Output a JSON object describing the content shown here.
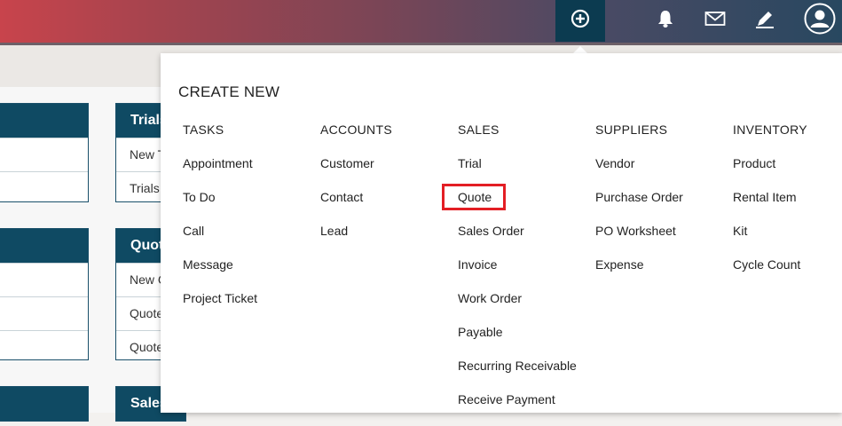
{
  "topbar": {
    "icons": [
      "plus-circle-icon",
      "bell-icon",
      "mail-icon",
      "pencil-icon",
      "user-icon"
    ]
  },
  "cards": {
    "trials": {
      "title": "Trials",
      "rows": [
        "New T",
        "Trials"
      ]
    },
    "quotes": {
      "title": "Quot",
      "rows": [
        "New C",
        "Quote",
        "Quote"
      ]
    },
    "sales": {
      "title": "Sales"
    }
  },
  "dropdown": {
    "title": "CREATE NEW",
    "columns": [
      {
        "header": "TASKS",
        "items": [
          "Appointment",
          "To Do",
          "Call",
          "Message",
          "Project Ticket"
        ]
      },
      {
        "header": "ACCOUNTS",
        "items": [
          "Customer",
          "Contact",
          "Lead"
        ]
      },
      {
        "header": "SALES",
        "items": [
          "Trial",
          "Quote",
          "Sales Order",
          "Invoice",
          "Work Order",
          "Payable",
          "Recurring Receivable",
          "Receive Payment"
        ]
      },
      {
        "header": "SUPPLIERS",
        "items": [
          "Vendor",
          "Purchase Order",
          "PO Worksheet",
          "Expense"
        ]
      },
      {
        "header": "INVENTORY",
        "items": [
          "Product",
          "Rental Item",
          "Kit",
          "Cycle Count"
        ]
      }
    ],
    "highlighted_item": "Quote",
    "highlight_color": "#e31e24"
  }
}
